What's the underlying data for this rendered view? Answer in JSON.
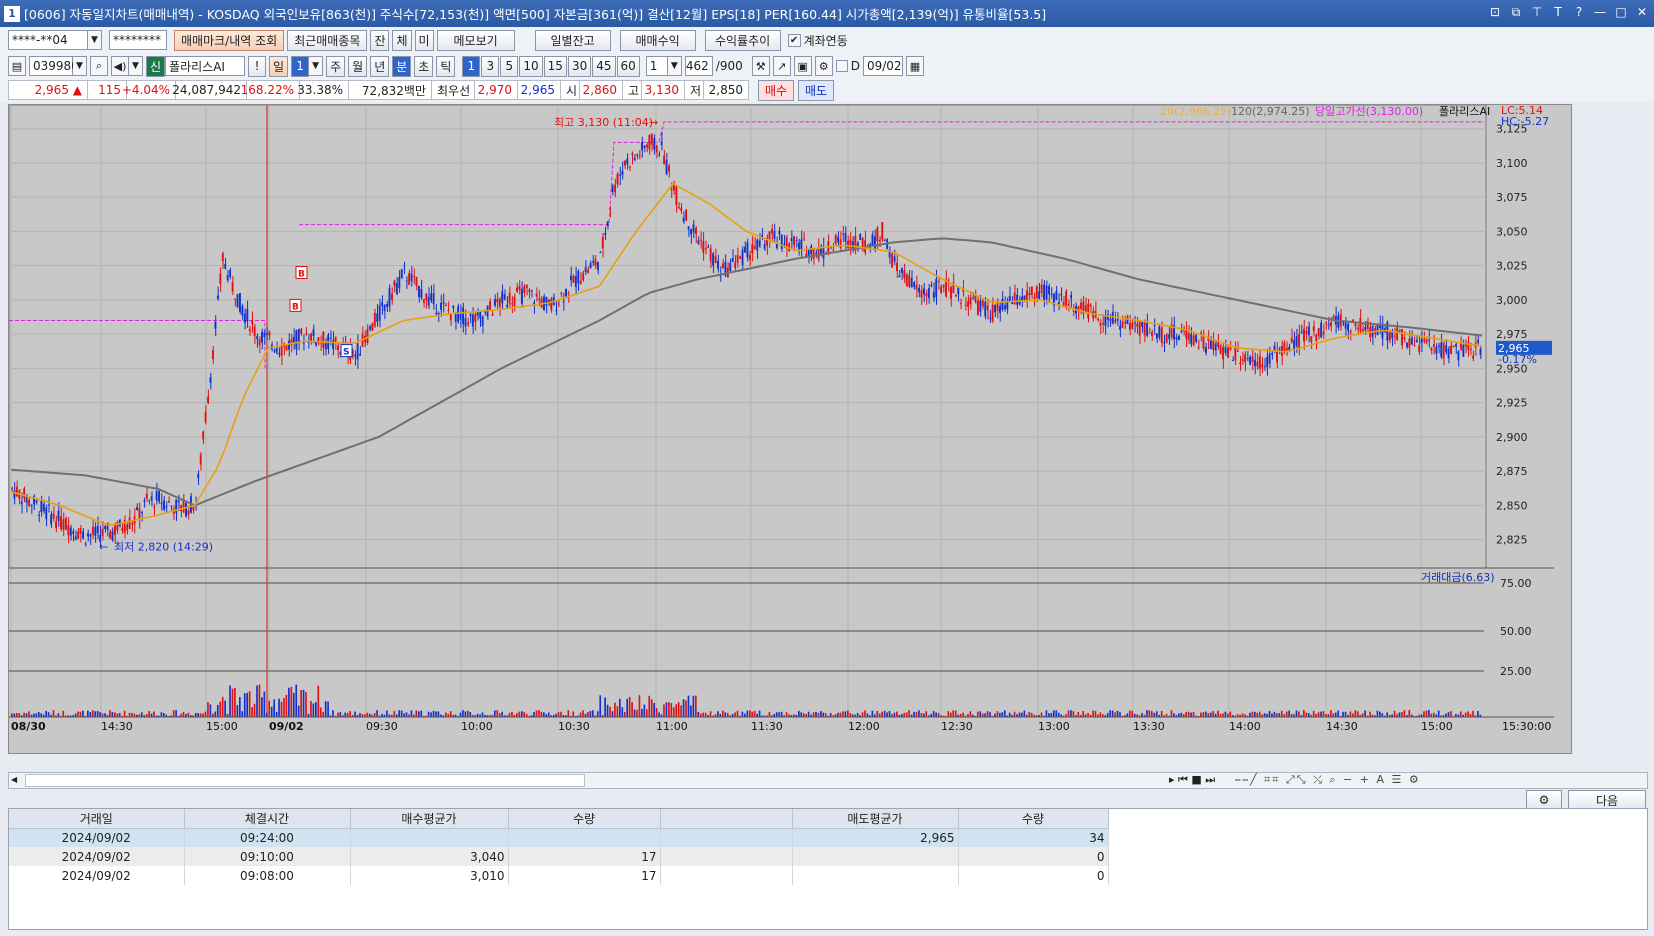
{
  "window": {
    "number": "1",
    "title": "[0606] 자동일지차트(매매내역) - KOSDAQ 외국인보유[863(천)] 주식수[72,153(천)] 액면[500] 자본금[361(억)] 결산[12월] EPS[18] PER[160.44] 시가총액[2,139(억)] 유통비율[53.5]"
  },
  "toolbar1": {
    "account": "****-**04",
    "password": "********",
    "btn_mark": "매매마크/내역 조회",
    "btn_recent": "최근매매종목",
    "btn_jan": "잔",
    "btn_che": "체",
    "btn_mi": "미",
    "btn_memo": "메모보기",
    "btn_daily": "일별잔고",
    "btn_profit": "매매수익",
    "btn_trend": "수익률추이",
    "link_label": "계좌연동"
  },
  "toolbar2": {
    "code": "039980",
    "name": "폴라리스AI",
    "sin": "신",
    "excl": "!",
    "day": "일",
    "day_n": "1",
    "week": "주",
    "month": "월",
    "year": "년",
    "minute": "분",
    "second": "초",
    "tick": "틱",
    "intervals": [
      "1",
      "3",
      "5",
      "10",
      "15",
      "30",
      "45",
      "60"
    ],
    "unit": "1",
    "count": "462",
    "count_total": "/900",
    "d_label": "D",
    "date": "09/02"
  },
  "quote": {
    "price": "2,965",
    "change": "115",
    "rate": "+4.04%",
    "volume": "24,087,942",
    "vol_rate": "168.22%",
    "turnover": "33.38%",
    "amount": "72,832백만",
    "best_label": "최우선",
    "ask": "2,970",
    "bid": "2,965",
    "open_label": "시",
    "open": "2,860",
    "high_label": "고",
    "high": "3,130",
    "low_label": "저",
    "low": "2,850",
    "buy_btn": "매수",
    "sell_btn": "매도"
  },
  "colors": {
    "up": "#e01010",
    "down": "#1030d0",
    "ma20": "#e8a010",
    "ma120": "#707070",
    "highline": "#e020e0"
  },
  "chart_data": {
    "type": "candlestick",
    "legend": {
      "ma20": "20(2,966.25)",
      "ma120": "120(2,974.25)",
      "high_line": "당일고가선(3,130.00)",
      "name": "폴라리스AI"
    },
    "lc": "LC:5.14",
    "hc": "HC:-5.27",
    "last_price": "2,965",
    "last_rate": "-0.17%",
    "high_annot": "최고 3,130 (11:04)",
    "low_annot": "최저 2,820 (14:29)",
    "volume_legend": "거래대금(6.63)",
    "y_ticks": [
      "3,125",
      "3,100",
      "3,075",
      "3,050",
      "3,025",
      "3,000",
      "2,975",
      "2,950",
      "2,925",
      "2,900",
      "2,875",
      "2,850",
      "2,825"
    ],
    "y_range": [
      2805,
      3135
    ],
    "vol_ticks": [
      "75.00",
      "50.00",
      "25.00"
    ],
    "x_ticks": [
      "08/30",
      "14:30",
      "15:00",
      "09/02",
      "09:30",
      "10:00",
      "10:30",
      "11:00",
      "11:30",
      "12:00",
      "12:30",
      "13:00",
      "13:30",
      "14:00",
      "14:30",
      "15:00"
    ],
    "x_end": "15:30:00",
    "price_path": [
      [
        0,
        2862
      ],
      [
        10,
        2850
      ],
      [
        20,
        2838
      ],
      [
        30,
        2828
      ],
      [
        40,
        2830
      ],
      [
        50,
        2840
      ],
      [
        55,
        2852
      ],
      [
        60,
        2855
      ],
      [
        65,
        2850
      ],
      [
        70,
        2848
      ],
      [
        75,
        2852
      ],
      [
        80,
        2930
      ],
      [
        83,
        2980
      ],
      [
        86,
        3030
      ],
      [
        90,
        3010
      ],
      [
        95,
        2990
      ],
      [
        100,
        2975
      ],
      [
        110,
        2965
      ],
      [
        120,
        2975
      ],
      [
        130,
        2968
      ],
      [
        140,
        2960
      ],
      [
        150,
        2990
      ],
      [
        160,
        3020
      ],
      [
        170,
        3000
      ],
      [
        180,
        2990
      ],
      [
        190,
        2985
      ],
      [
        200,
        3000
      ],
      [
        210,
        3005
      ],
      [
        220,
        2995
      ],
      [
        230,
        3015
      ],
      [
        240,
        3030
      ],
      [
        245,
        3080
      ],
      [
        250,
        3100
      ],
      [
        255,
        3105
      ],
      [
        260,
        3115
      ],
      [
        265,
        3110
      ],
      [
        270,
        3080
      ],
      [
        275,
        3060
      ],
      [
        280,
        3045
      ],
      [
        290,
        3020
      ],
      [
        300,
        3035
      ],
      [
        310,
        3045
      ],
      [
        320,
        3040
      ],
      [
        330,
        3035
      ],
      [
        340,
        3045
      ],
      [
        350,
        3040
      ],
      [
        355,
        3050
      ],
      [
        360,
        3025
      ],
      [
        370,
        3005
      ],
      [
        380,
        3010
      ],
      [
        390,
        3000
      ],
      [
        400,
        2990
      ],
      [
        410,
        3000
      ],
      [
        420,
        3005
      ],
      [
        430,
        3000
      ],
      [
        440,
        2990
      ],
      [
        450,
        2985
      ],
      [
        460,
        2980
      ],
      [
        470,
        2975
      ],
      [
        480,
        2975
      ],
      [
        490,
        2965
      ],
      [
        500,
        2960
      ],
      [
        510,
        2955
      ],
      [
        520,
        2965
      ],
      [
        530,
        2975
      ],
      [
        540,
        2985
      ],
      [
        550,
        2980
      ],
      [
        560,
        2978
      ],
      [
        570,
        2970
      ],
      [
        580,
        2965
      ],
      [
        590,
        2962
      ],
      [
        600,
        2965
      ]
    ],
    "ma20_path": [
      [
        0,
        2860
      ],
      [
        20,
        2850
      ],
      [
        40,
        2835
      ],
      [
        60,
        2843
      ],
      [
        75,
        2850
      ],
      [
        85,
        2880
      ],
      [
        95,
        2930
      ],
      [
        105,
        2965
      ],
      [
        120,
        2970
      ],
      [
        140,
        2968
      ],
      [
        160,
        2985
      ],
      [
        180,
        2990
      ],
      [
        200,
        2993
      ],
      [
        220,
        2998
      ],
      [
        240,
        3010
      ],
      [
        255,
        3050
      ],
      [
        270,
        3085
      ],
      [
        285,
        3070
      ],
      [
        300,
        3050
      ],
      [
        320,
        3036
      ],
      [
        340,
        3040
      ],
      [
        360,
        3035
      ],
      [
        380,
        3015
      ],
      [
        400,
        2998
      ],
      [
        420,
        3000
      ],
      [
        440,
        2990
      ],
      [
        460,
        2985
      ],
      [
        480,
        2978
      ],
      [
        500,
        2965
      ],
      [
        520,
        2962
      ],
      [
        540,
        2972
      ],
      [
        560,
        2978
      ],
      [
        580,
        2972
      ],
      [
        600,
        2966
      ]
    ],
    "ma120_path": [
      [
        0,
        2876
      ],
      [
        30,
        2872
      ],
      [
        60,
        2862
      ],
      [
        75,
        2850
      ],
      [
        100,
        2868
      ],
      [
        150,
        2900
      ],
      [
        200,
        2950
      ],
      [
        240,
        2985
      ],
      [
        260,
        3005
      ],
      [
        280,
        3015
      ],
      [
        320,
        3030
      ],
      [
        360,
        3042
      ],
      [
        380,
        3045
      ],
      [
        400,
        3042
      ],
      [
        430,
        3030
      ],
      [
        460,
        3015
      ],
      [
        500,
        3000
      ],
      [
        540,
        2985
      ],
      [
        570,
        2980
      ],
      [
        600,
        2974
      ]
    ],
    "n_points": 600
  },
  "scroll": {
    "controls": "▸ ⏮ ■ ⏭"
  },
  "grid": {
    "gear": "⚙",
    "next": "다음",
    "headers": [
      "거래일",
      "체결시간",
      "매수평균가",
      "수량",
      "",
      "매도평균가",
      "수량"
    ],
    "rows": [
      [
        "2024/09/02",
        "09:24:00",
        "",
        "",
        "",
        "2,965",
        "34"
      ],
      [
        "2024/09/02",
        "09:10:00",
        "3,040",
        "17",
        "",
        "",
        "0"
      ],
      [
        "2024/09/02",
        "09:08:00",
        "3,010",
        "17",
        "",
        "",
        "0"
      ]
    ]
  }
}
